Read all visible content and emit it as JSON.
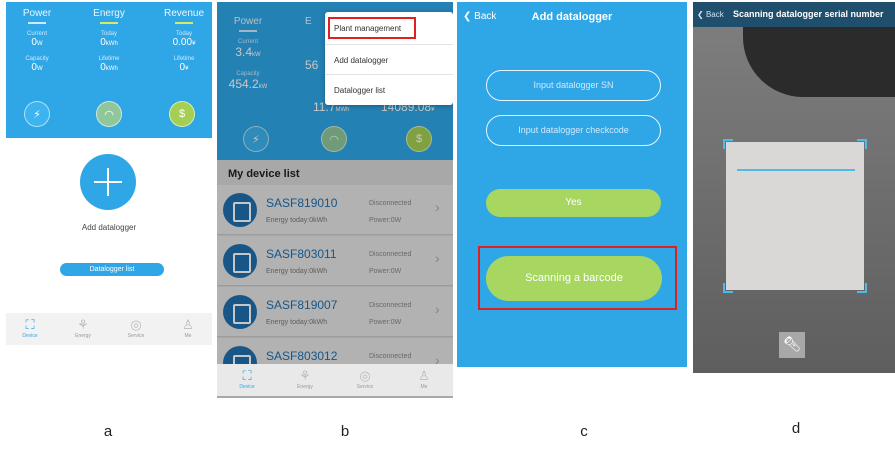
{
  "panel_a": {
    "stats": {
      "power": "Power",
      "energy": "Energy",
      "revenue": "Revenue",
      "current_label": "Current",
      "current_value": "0",
      "current_unit": "W",
      "today_energy_label": "Today",
      "today_energy_value": "0",
      "today_energy_unit": "kWh",
      "today_revenue_label": "Today",
      "today_revenue_value": "0.00",
      "today_revenue_unit": "¥",
      "capacity_label": "Capacity",
      "capacity_value": "0",
      "capacity_unit": "W",
      "lifetime_energy_label": "Lifetime",
      "lifetime_energy_value": "0",
      "lifetime_energy_unit": "kWh",
      "lifetime_revenue_label": "Lifetime",
      "lifetime_revenue_value": "0",
      "lifetime_revenue_unit": "¥"
    },
    "add_label": "Add datalogger",
    "datalogger_list_button": "Datalogger list",
    "tabs": [
      "Device",
      "Energy",
      "Service",
      "Me"
    ]
  },
  "panel_b": {
    "stats": {
      "power": "Power",
      "energy_short": "E",
      "current_label": "Current",
      "current_value": "3.4",
      "current_unit": "kW",
      "today_partial": "56",
      "capacity_label": "Capacity",
      "capacity_value": "454.2",
      "capacity_unit": "kW",
      "lifetime_energy_value": "11.7",
      "lifetime_energy_unit": "MWh",
      "lifetime_revenue_value": "14089.08",
      "lifetime_revenue_unit": "¥"
    },
    "menu": [
      "Plant management",
      "Add datalogger",
      "Datalogger list"
    ],
    "list_header": "My device list",
    "devices": [
      {
        "name": "SASF819010",
        "energy": "Energy today:0kWh",
        "status": "Disconnected",
        "power": "Power:0W"
      },
      {
        "name": "SASF803011",
        "energy": "Energy today:0kWh",
        "status": "Disconnected",
        "power": "Power:0W"
      },
      {
        "name": "SASF819007",
        "energy": "Energy today:0kWh",
        "status": "Disconnected",
        "power": "Power:0W"
      },
      {
        "name": "SASF803012",
        "energy": "",
        "status": "Disconnected",
        "power": ""
      }
    ],
    "tabs": [
      "Device",
      "Energy",
      "Service",
      "Me"
    ]
  },
  "panel_c": {
    "back": "Back",
    "title": "Add datalogger",
    "sn_placeholder": "Input datalogger SN",
    "checkcode_placeholder": "Input datalogger checkcode",
    "yes_button": "Yes",
    "scan_button": "Scanning a barcode"
  },
  "panel_d": {
    "back": "Back",
    "title": "Scanning datalogger serial number"
  },
  "sublabels": [
    "a",
    "b",
    "c",
    "d"
  ],
  "colors": {
    "accent_blue": "#2fa6e6",
    "green_button": "#a7d760",
    "highlight_red": "#e0201e"
  }
}
